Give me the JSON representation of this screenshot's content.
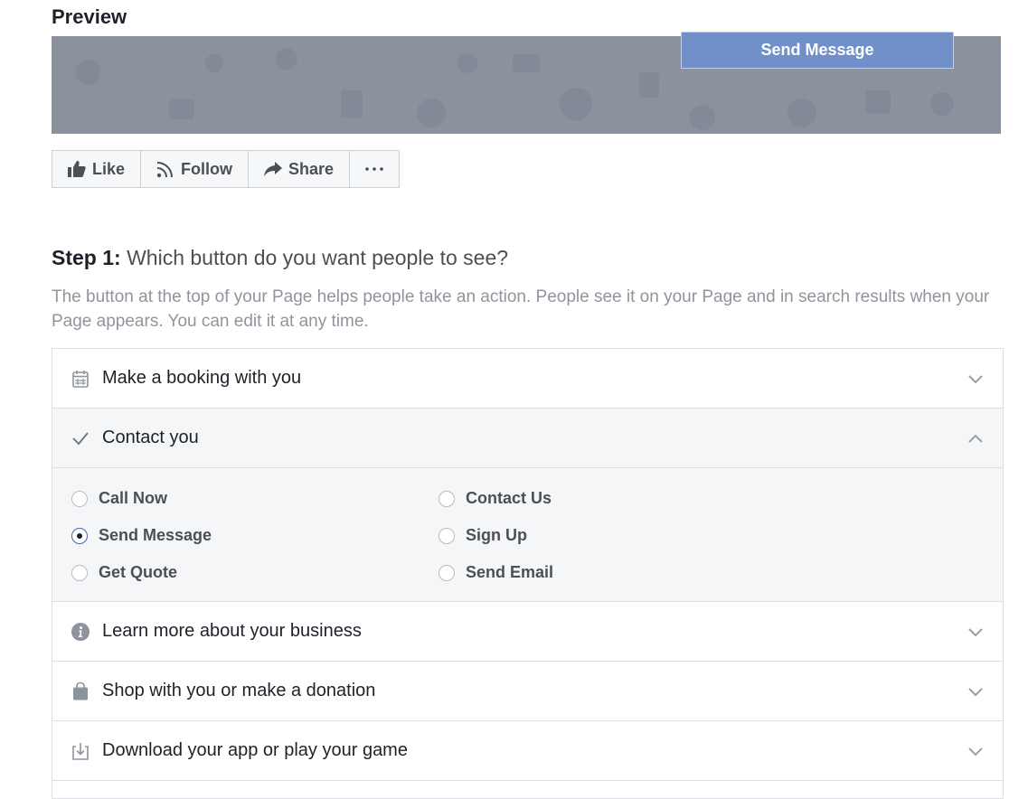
{
  "preview": {
    "title": "Preview"
  },
  "cover": {
    "cta_label": "Send Message",
    "cta_color": "#7190c9",
    "background_color": "#8b919d"
  },
  "action_bar": {
    "buttons": [
      {
        "label": "Like",
        "icon": "thumbs-up-icon"
      },
      {
        "label": "Follow",
        "icon": "rss-icon"
      },
      {
        "label": "Share",
        "icon": "share-arrow-icon"
      },
      {
        "label": "",
        "icon": "more-dots-icon"
      }
    ]
  },
  "step1": {
    "prefix": "Step 1:",
    "question": "Which button do you want people to see?",
    "description": "The button at the top of your Page helps people take an action. People see it on your Page and in search results when your Page appears. You can edit it at any time."
  },
  "categories": [
    {
      "label": "Make a booking with you",
      "icon": "calendar-icon",
      "expanded": false
    },
    {
      "label": "Contact you",
      "icon": "checkmark-icon",
      "expanded": true
    },
    {
      "label": "Learn more about your business",
      "icon": "info-icon",
      "expanded": false
    },
    {
      "label": "Shop with you or make a donation",
      "icon": "shopping-bag-icon",
      "expanded": false
    },
    {
      "label": "Download your app or play your game",
      "icon": "download-icon",
      "expanded": false
    }
  ],
  "contact_options": {
    "selected": "Send Message",
    "items": [
      {
        "label": "Call Now",
        "checked": false
      },
      {
        "label": "Send Message",
        "checked": true
      },
      {
        "label": "Get Quote",
        "checked": false
      },
      {
        "label": "Contact Us",
        "checked": false
      },
      {
        "label": "Sign Up",
        "checked": false
      },
      {
        "label": "Send Email",
        "checked": false
      }
    ]
  }
}
